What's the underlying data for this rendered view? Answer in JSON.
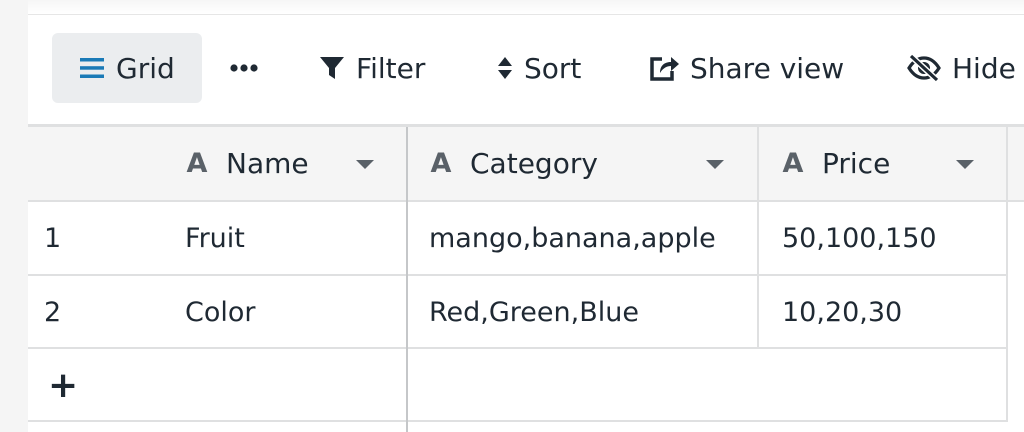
{
  "toolbar": {
    "grid_label": "Grid",
    "more_label": "•••",
    "filter_label": "Filter",
    "sort_label": "Sort",
    "share_label": "Share view",
    "hide_label": "Hide"
  },
  "columns": [
    {
      "type_icon": "A",
      "label": "Name"
    },
    {
      "type_icon": "A",
      "label": "Category"
    },
    {
      "type_icon": "A",
      "label": "Price"
    }
  ],
  "rows": [
    {
      "index": "1",
      "name": "Fruit",
      "category": "mango,banana,apple",
      "price": "50,100,150"
    },
    {
      "index": "2",
      "name": "Color",
      "category": "Red,Green,Blue",
      "price": "10,20,30"
    }
  ],
  "add_row_label": "+",
  "colors": {
    "accent": "#1a7ab7",
    "header_bg": "#f5f5f5",
    "border": "#dfe0e1"
  },
  "icons": [
    "grid-lines-icon",
    "more-icon",
    "filter-icon",
    "sort-icon",
    "share-icon",
    "hide-eye-icon",
    "text-type-icon",
    "caret-down-icon",
    "plus-icon"
  ]
}
